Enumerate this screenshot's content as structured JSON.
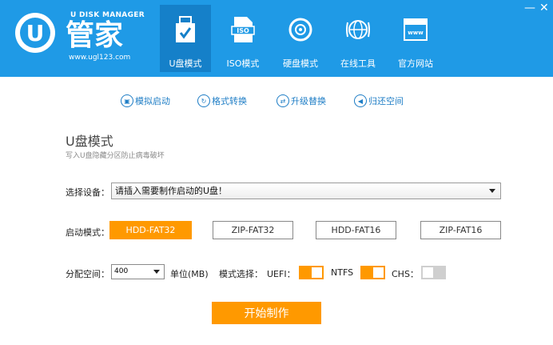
{
  "header": {
    "logo_top": "U DISK MANAGER",
    "logo_main": "管家",
    "logo_url": "www.ugl123.com",
    "logo_letter": "U",
    "tabs": [
      {
        "label": "U盘模式",
        "icon": "usb-drive-icon",
        "active": true
      },
      {
        "label": "ISO模式",
        "icon": "iso-file-icon",
        "active": false
      },
      {
        "label": "硬盘模式",
        "icon": "disc-icon",
        "active": false
      },
      {
        "label": "在线工具",
        "icon": "globe-icon",
        "active": false
      },
      {
        "label": "官方网站",
        "icon": "website-icon",
        "active": false
      }
    ],
    "minimize": "—",
    "close": "✕"
  },
  "toolbar": {
    "items": [
      {
        "label": "模拟启动",
        "icon": "monitor-icon"
      },
      {
        "label": "格式转换",
        "icon": "refresh-icon"
      },
      {
        "label": "升级替换",
        "icon": "swap-icon"
      },
      {
        "label": "归还空间",
        "icon": "back-icon"
      }
    ]
  },
  "section": {
    "title": "U盘模式",
    "subtitle": "写入U盘隐藏分区防止病毒破坏"
  },
  "device": {
    "label": "选择设备：",
    "value": "请插入需要制作启动的U盘！"
  },
  "boot": {
    "label": "启动模式：",
    "options": [
      "HDD-FAT32",
      "ZIP-FAT32",
      "HDD-FAT16",
      "ZIP-FAT16"
    ],
    "selected": "HDD-FAT32"
  },
  "space": {
    "label": "分配空间：",
    "value": "400",
    "unit": "单位(MB)",
    "mode_label": "模式选择：",
    "uefi_label": "UEFI：",
    "uefi_on": true,
    "ntfs_label": "NTFS",
    "ntfs_on": true,
    "chs_label": "CHS：",
    "chs_on": false
  },
  "start_button": "开始制作",
  "colors": {
    "header_bg": "#1f9ae6",
    "active_tab": "#1580c9",
    "accent_orange": "#ff9900",
    "toolbar_blue": "#1f7ec6"
  }
}
